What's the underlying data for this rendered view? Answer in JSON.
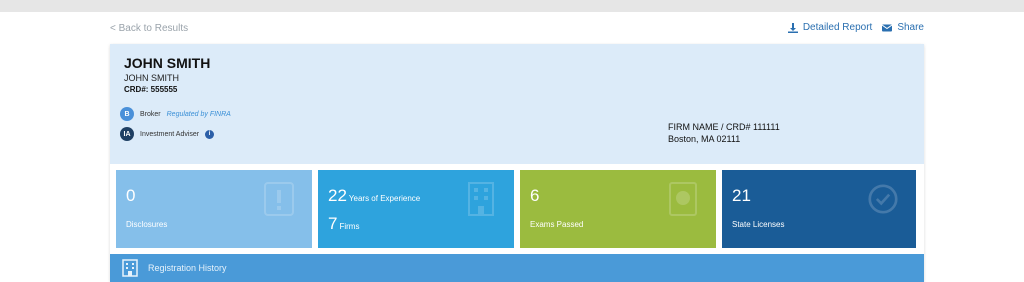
{
  "nav": {
    "back_label": "< Back to Results",
    "detailed_report_label": "Detailed Report",
    "share_label": "Share"
  },
  "profile": {
    "name": "JOHN SMITH",
    "name_sub": "JOHN SMITH",
    "crd": "CRD#: 555555",
    "broker_badge": "B",
    "broker_label": "Broker",
    "broker_regulated": "Regulated by FINRA",
    "advisor_badge": "IA",
    "advisor_label": "Investment Adviser",
    "firm_line1": "FIRM NAME / CRD# 111111",
    "firm_line2": "Boston, MA 02111"
  },
  "tiles": [
    {
      "value": "0",
      "label": "Disclosures",
      "icon": "document-alert-icon",
      "color": "#85bfea"
    },
    {
      "value": "22",
      "inline": "Years of Experience",
      "value2": "7",
      "inline2": "Firms",
      "icon": "building-icon",
      "color": "#2ea3dd"
    },
    {
      "value": "6",
      "label": "Exams Passed",
      "icon": "certificate-icon",
      "color": "#9bbb3f"
    },
    {
      "value": "21",
      "label": "State Licenses",
      "icon": "check-circle-icon",
      "color": "#1a5c97"
    }
  ],
  "registration_history": {
    "label": "Registration History",
    "icon": "building-icon"
  },
  "colors": {
    "accent": "#2a6fb0",
    "header_bg": "#dcebf9"
  }
}
